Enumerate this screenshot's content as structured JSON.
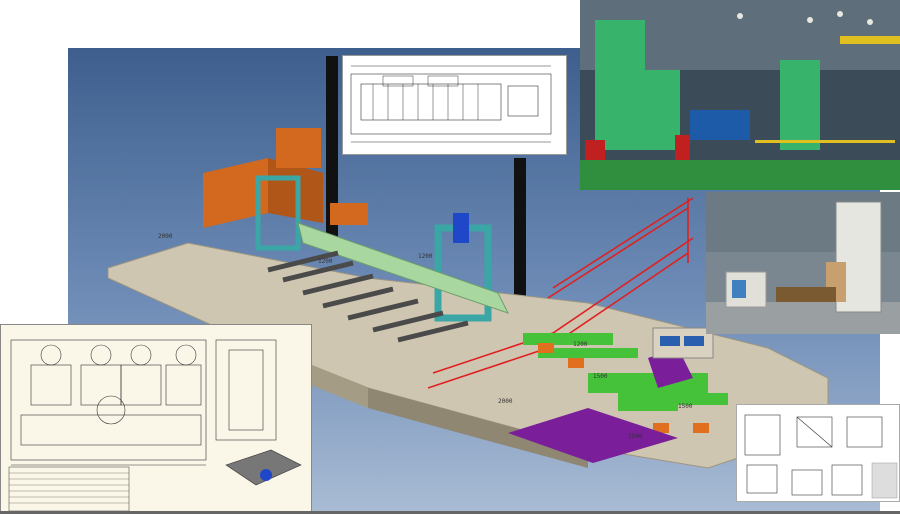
{
  "render": {
    "dim_labels": [
      "2000",
      "1200",
      "2000",
      "1200",
      "1200",
      "1500",
      "1500",
      "1500"
    ],
    "colors": {
      "orange_housing": "#d2691e",
      "teal_frame": "#3aa6a6",
      "green_conveyor": "#46c23a",
      "red_railing": "#e02020",
      "purple_pit": "#7a1e9a",
      "concrete": "#c8bea8"
    }
  },
  "photos": {
    "hall": {
      "icon": "factory-hall-photo"
    },
    "machine": {
      "icon": "press-machine-photo"
    }
  },
  "drawings": {
    "top": {
      "icon": "plan-view-drawing"
    },
    "bottom_left": {
      "icon": "gearbox-assembly-drawing"
    },
    "bottom_right": {
      "icon": "frame-detail-drawing"
    }
  }
}
